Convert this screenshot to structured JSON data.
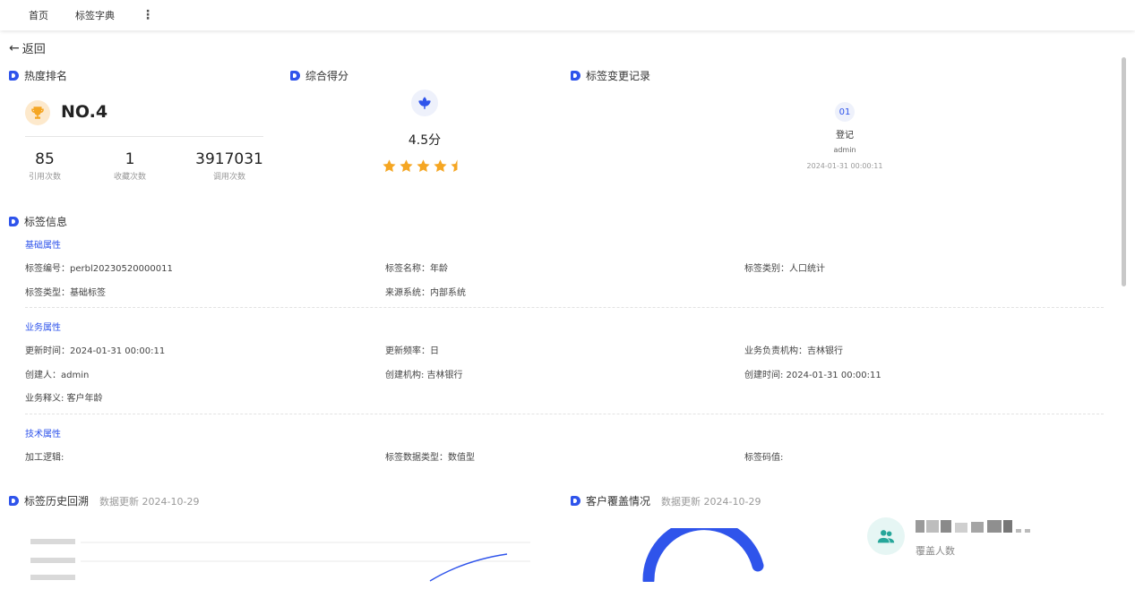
{
  "nav": {
    "tabs": [
      "首页",
      "标签字典"
    ],
    "more": "⋮"
  },
  "back": {
    "label": "返回"
  },
  "rank": {
    "title": "热度排名",
    "rank": "NO.4",
    "stats": [
      {
        "value": "85",
        "label": "引用次数"
      },
      {
        "value": "1",
        "label": "收藏次数"
      },
      {
        "value": "3917031",
        "label": "调用次数"
      }
    ]
  },
  "score": {
    "title": "综合得分",
    "value": "4.5分",
    "rating": 4.5,
    "star_color": "#f5a623"
  },
  "record": {
    "title": "标签变更记录",
    "index": "01",
    "action": "登记",
    "user": "admin",
    "time": "2024-01-31 00:00:11"
  },
  "info": {
    "title": "标签信息",
    "basic": {
      "title": "基础属性",
      "fields": [
        "标签编号：perbl20230520000011",
        "标签名称：年龄",
        "标签类别：人口统计",
        "标签类型：基础标签",
        "来源系统：内部系统"
      ]
    },
    "business": {
      "title": "业务属性",
      "fields": [
        "更新时间：2024-01-31 00:00:11",
        "更新频率：日",
        "业务负责机构：吉林银行",
        "创建人：admin",
        "创建机构: 吉林银行",
        "创建时间: 2024-01-31 00:00:11",
        "业务释义: 客户年龄"
      ]
    },
    "tech": {
      "title": "技术属性",
      "fields": [
        "加工逻辑:",
        "标签数据类型：数值型",
        "标签码值:"
      ]
    }
  },
  "history": {
    "title": "标签历史回溯",
    "note": "数据更新 2024-10-29"
  },
  "coverage": {
    "title": "客户覆盖情况",
    "note": "数据更新 2024-10-29",
    "label": "覆盖人数",
    "accent": "#2f54eb"
  },
  "colors": {
    "accent": "#2f54eb",
    "group_title": "#2f54eb",
    "trophy_bg": "#fde9cc",
    "trophy": "#f5a623"
  }
}
